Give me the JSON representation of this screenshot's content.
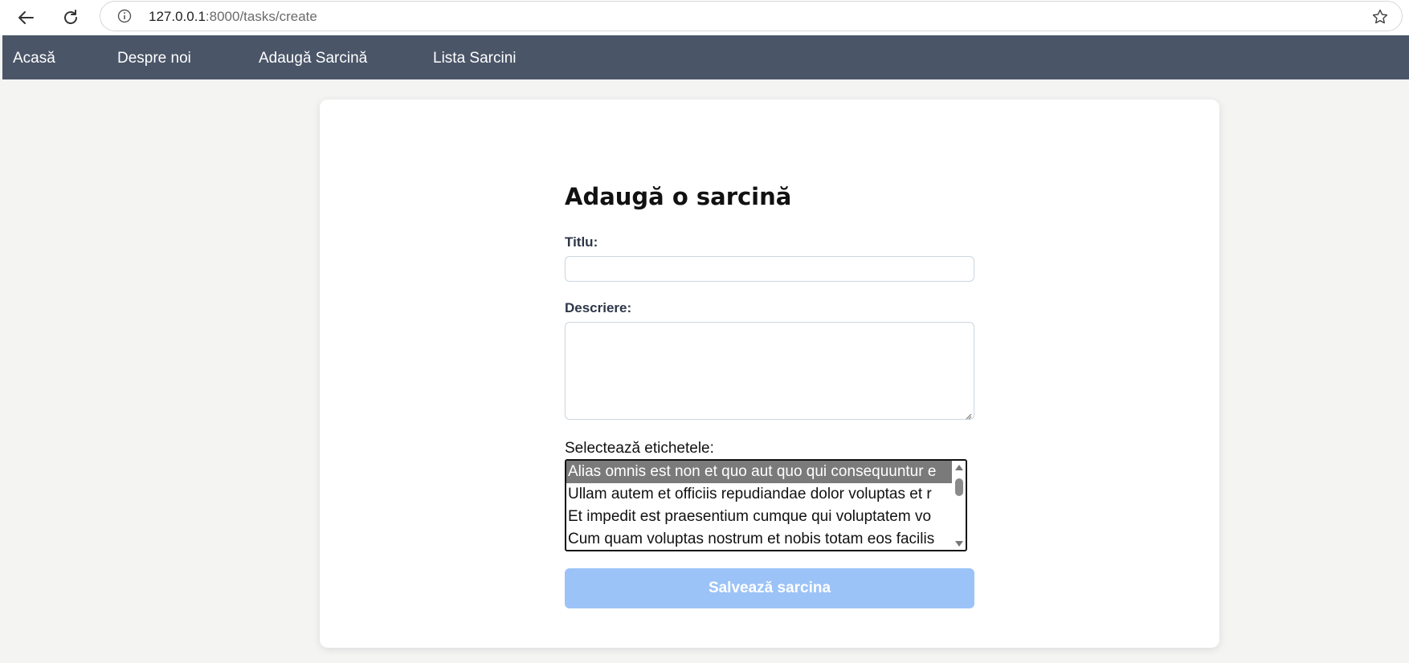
{
  "browser": {
    "url_host": "127.0.0.1",
    "url_rest": ":8000/tasks/create",
    "icons": {
      "back": "back-arrow-icon",
      "reload": "reload-icon",
      "info": "site-info-icon",
      "bookmark": "star-icon"
    }
  },
  "navbar": {
    "items": [
      {
        "label": "Acasă"
      },
      {
        "label": "Despre noi"
      },
      {
        "label": "Adaugă Sarcină"
      },
      {
        "label": "Lista Sarcini"
      }
    ]
  },
  "form": {
    "title": "Adaugă o sarcină",
    "title_label": "Titlu:",
    "title_value": "",
    "description_label": "Descriere:",
    "description_value": "",
    "tags_label": "Selectează etichetele:",
    "tags_options": [
      {
        "label": "Alias omnis est non et quo aut quo qui consequuntur e",
        "selected": true
      },
      {
        "label": "Ullam autem et officiis repudiandae dolor voluptas et r",
        "selected": false
      },
      {
        "label": "Et impedit est praesentium cumque qui voluptatem vo",
        "selected": false
      },
      {
        "label": "Cum quam voluptas nostrum et nobis totam eos facilis",
        "selected": false
      }
    ],
    "submit_label": "Salvează sarcina"
  },
  "colors": {
    "navbar_bg": "#4a5568",
    "page_bg": "#f4f4f3",
    "submit_bg": "#9cc3f7",
    "selected_option_bg": "#7a7a7a"
  }
}
